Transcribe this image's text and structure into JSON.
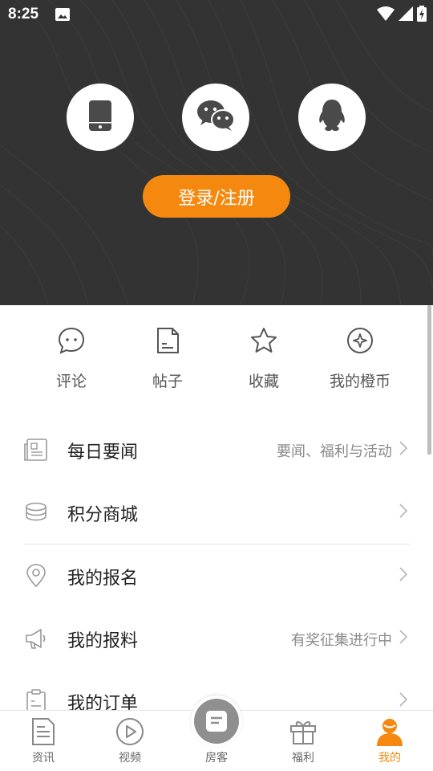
{
  "status_bar": {
    "time": "8:25",
    "icons": [
      "image-icon",
      "wifi-icon",
      "cell-signal-icon",
      "battery-icon"
    ]
  },
  "login": {
    "methods": [
      {
        "name": "phone",
        "icon": "phone-icon"
      },
      {
        "name": "wechat",
        "icon": "wechat-icon"
      },
      {
        "name": "qq",
        "icon": "qq-penguin-icon"
      }
    ],
    "button_label": "登录/注册"
  },
  "quick_actions": [
    {
      "label": "评论",
      "icon": "comment-icon"
    },
    {
      "label": "帖子",
      "icon": "post-icon"
    },
    {
      "label": "收藏",
      "icon": "star-icon"
    },
    {
      "label": "我的橙币",
      "icon": "coin-icon"
    }
  ],
  "menu": [
    {
      "label": "每日要闻",
      "sub": "要闻、福利与活动",
      "icon": "news-icon"
    },
    {
      "label": "积分商城",
      "sub": "",
      "icon": "coins-stack-icon"
    },
    {
      "label": "我的报名",
      "sub": "",
      "icon": "location-pin-icon"
    },
    {
      "label": "我的报料",
      "sub": "有奖征集进行中",
      "icon": "megaphone-icon"
    },
    {
      "label": "我的订单",
      "sub": "",
      "icon": "clipboard-icon"
    }
  ],
  "tabs": [
    {
      "label": "资讯",
      "icon": "document-icon",
      "active": false
    },
    {
      "label": "视频",
      "icon": "play-icon",
      "active": false
    },
    {
      "label": "房客",
      "icon": "home-fab-icon",
      "active": false
    },
    {
      "label": "福利",
      "icon": "gift-icon",
      "active": false
    },
    {
      "label": "我的",
      "icon": "person-icon",
      "active": true
    }
  ],
  "colors": {
    "accent": "#f5890f",
    "header_bg": "#333333",
    "text_primary": "#222222",
    "text_secondary": "#8a8a8a"
  }
}
